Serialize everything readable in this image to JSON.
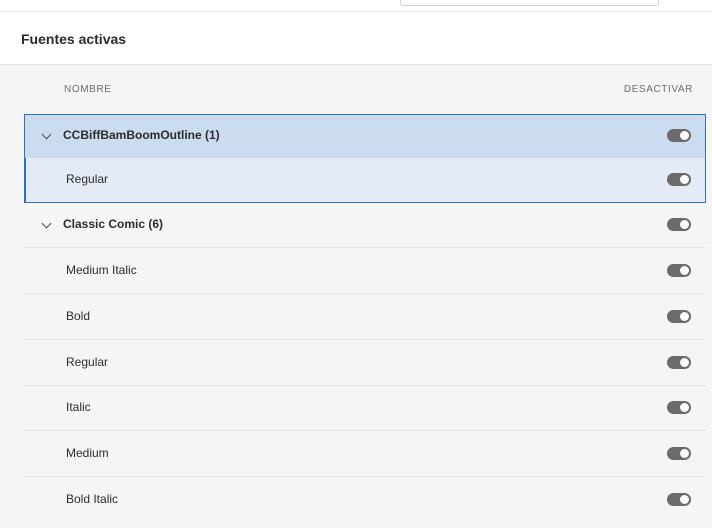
{
  "section": {
    "title": "Fuentes activas"
  },
  "columns": {
    "name": "NOMBRE",
    "toggle": "DESACTIVAR"
  },
  "rows": [
    {
      "kind": "family",
      "label": "CCBiffBamBoomOutline (1)",
      "active": true,
      "selected": true
    },
    {
      "kind": "style",
      "label": "Regular",
      "active": true,
      "selected": true
    },
    {
      "kind": "family",
      "label": "Classic Comic (6)",
      "active": true
    },
    {
      "kind": "style",
      "label": "Medium Italic",
      "active": true
    },
    {
      "kind": "style",
      "label": "Bold",
      "active": true
    },
    {
      "kind": "style",
      "label": "Regular",
      "active": true
    },
    {
      "kind": "style",
      "label": "Italic",
      "active": true
    },
    {
      "kind": "style",
      "label": "Medium",
      "active": true
    },
    {
      "kind": "style",
      "label": "Bold Italic",
      "active": true
    }
  ],
  "colors": {
    "selection_border": "#2d72c8",
    "selected_family_bg": "#cbdcf0",
    "selected_style_bg": "#e4ebf5",
    "toggle_on": "#6b6b6b"
  }
}
